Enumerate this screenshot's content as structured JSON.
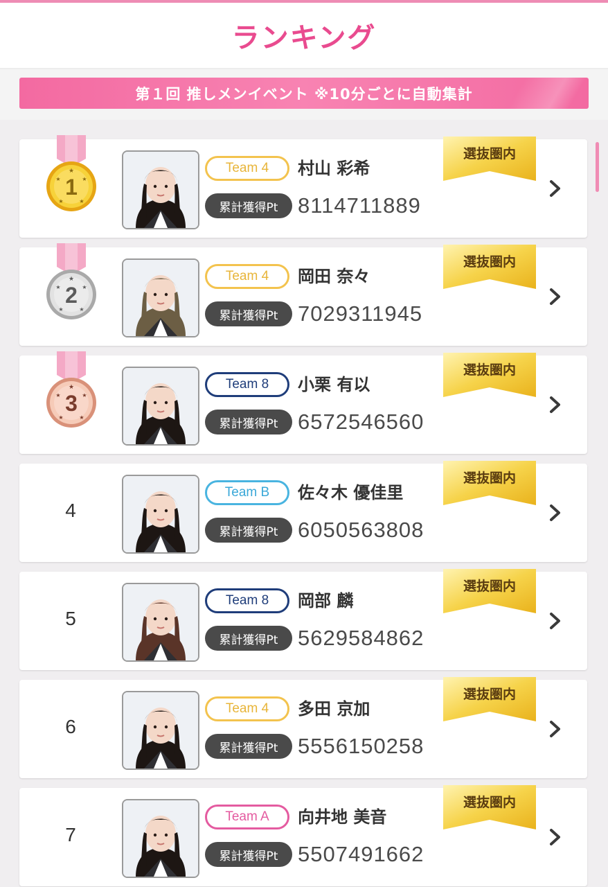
{
  "header": {
    "title": "ランキング"
  },
  "event_banner": {
    "text": "第１回 推しメンイベント ※10分ごとに自動集計"
  },
  "pt_label": "累計獲得Pt",
  "badge_label": "選抜圏内",
  "colors": {
    "accent": "#e94b8f",
    "team_4": "#f3c34e",
    "team_8": "#1f3d7a",
    "team_b": "#49b4e0",
    "team_a": "#e45ba0",
    "medal_gold": "#f2c21b",
    "medal_silver": "#c6c6c6",
    "medal_bronze": "#ebb29a"
  },
  "rankings": [
    {
      "rank": "1",
      "medal": "gold",
      "team": "Team 4",
      "team_color": "#f3c34e",
      "team_text": "#e8b53a",
      "name": "村山 彩希",
      "points": "8114711889",
      "badge": "選抜圏内",
      "hair": "#1d1613"
    },
    {
      "rank": "2",
      "medal": "silver",
      "team": "Team 4",
      "team_color": "#f3c34e",
      "team_text": "#e8b53a",
      "name": "岡田 奈々",
      "points": "7029311945",
      "badge": "選抜圏内",
      "hair": "#6c5e44"
    },
    {
      "rank": "3",
      "medal": "bronze",
      "team": "Team 8",
      "team_color": "#1f3d7a",
      "team_text": "#1f3d7a",
      "name": "小栗 有以",
      "points": "6572546560",
      "badge": "選抜圏内",
      "hair": "#1d1613"
    },
    {
      "rank": "4",
      "medal": "",
      "team": "Team B",
      "team_color": "#49b4e0",
      "team_text": "#3aa8d8",
      "name": "佐々木 優佳里",
      "points": "6050563808",
      "badge": "選抜圏内",
      "hair": "#1d1613"
    },
    {
      "rank": "5",
      "medal": "",
      "team": "Team 8",
      "team_color": "#1f3d7a",
      "team_text": "#1f3d7a",
      "name": "岡部 麟",
      "points": "5629584862",
      "badge": "選抜圏内",
      "hair": "#5a3428"
    },
    {
      "rank": "6",
      "medal": "",
      "team": "Team 4",
      "team_color": "#f3c34e",
      "team_text": "#e8b53a",
      "name": "多田 京加",
      "points": "5556150258",
      "badge": "選抜圏内",
      "hair": "#1d1613"
    },
    {
      "rank": "7",
      "medal": "",
      "team": "Team A",
      "team_color": "#e45ba0",
      "team_text": "#e45ba0",
      "name": "向井地 美音",
      "points": "5507491662",
      "badge": "選抜圏内",
      "hair": "#1d1613"
    }
  ]
}
